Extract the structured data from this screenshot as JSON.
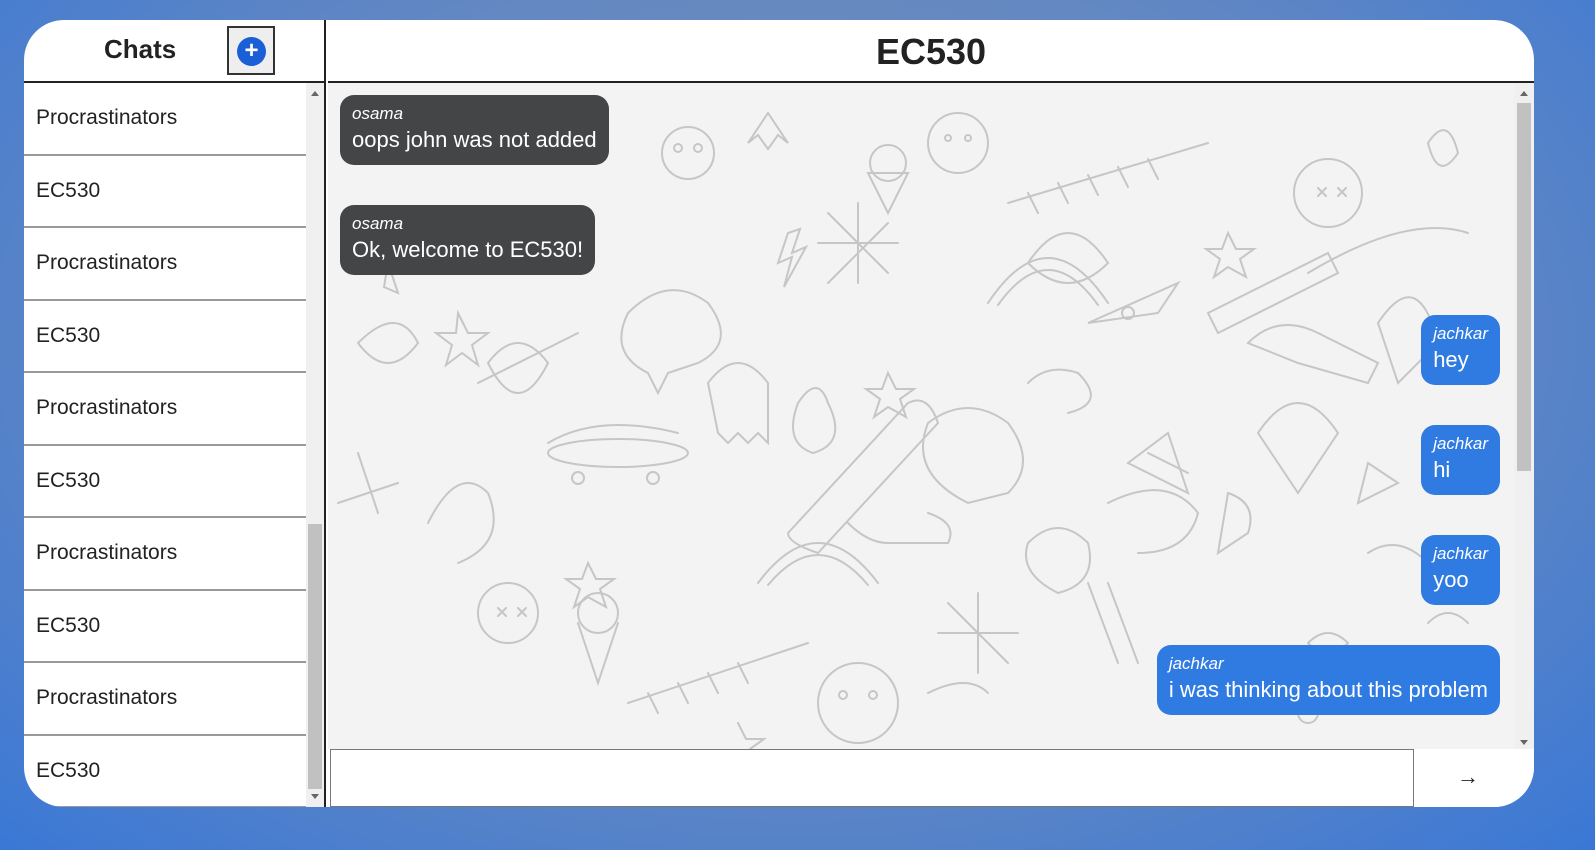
{
  "sidebar": {
    "title": "Chats",
    "add_icon": "plus-circle-icon",
    "add_symbol": "+",
    "items": [
      {
        "label": "Procrastinators"
      },
      {
        "label": "EC530"
      },
      {
        "label": "Procrastinators"
      },
      {
        "label": "EC530"
      },
      {
        "label": "Procrastinators"
      },
      {
        "label": "EC530"
      },
      {
        "label": "Procrastinators"
      },
      {
        "label": "EC530"
      },
      {
        "label": "Procrastinators"
      },
      {
        "label": "EC530"
      }
    ]
  },
  "chat": {
    "title": "EC530",
    "messages": [
      {
        "author": "osama",
        "text": "oops john was not added",
        "mine": false
      },
      {
        "author": "osama",
        "text": "Ok, welcome to EC530!",
        "mine": false
      },
      {
        "author": "jachkar",
        "text": "hey",
        "mine": true
      },
      {
        "author": "jachkar",
        "text": "hi",
        "mine": true
      },
      {
        "author": "jachkar",
        "text": "yoo",
        "mine": true
      },
      {
        "author": "jachkar",
        "text": "i was thinking about this problem",
        "mine": true
      }
    ],
    "input_value": "",
    "send_icon": "arrow-right-icon",
    "send_symbol": "→"
  },
  "colors": {
    "accent": "#1b5fd6",
    "own_message": "#2f7be2",
    "other_message": "#444546",
    "background": "#5f86c4"
  }
}
